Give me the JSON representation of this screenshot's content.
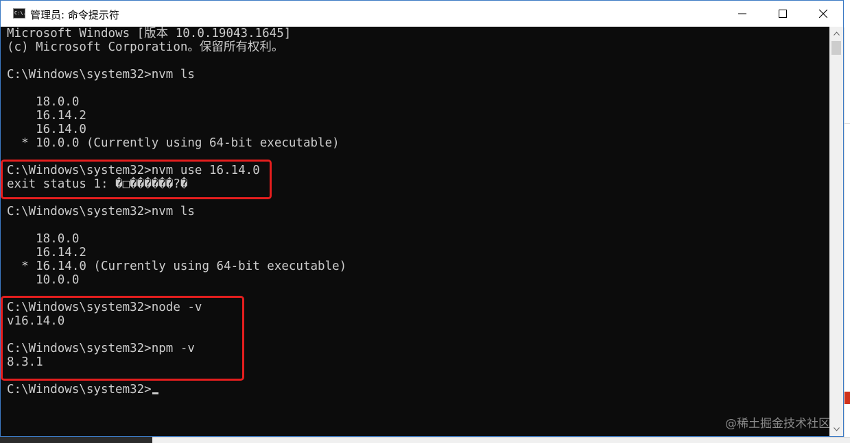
{
  "window": {
    "title": "管理员: 命令提示符",
    "app_icon_text": "C:\\.",
    "buttons": {
      "minimize_icon": "minimize-icon",
      "maximize_icon": "maximize-icon",
      "close_icon": "close-icon"
    }
  },
  "console": {
    "lines": [
      "Microsoft Windows [版本 10.0.19043.1645]",
      "(c) Microsoft Corporation。保留所有权利。",
      "",
      "C:\\Windows\\system32>nvm ls",
      "",
      "    18.0.0",
      "    16.14.2",
      "    16.14.0",
      "  * 10.0.0 (Currently using 64-bit executable)",
      "",
      "C:\\Windows\\system32>nvm use 16.14.0",
      "exit status 1: �□������?�",
      "",
      "C:\\Windows\\system32>nvm ls",
      "",
      "    18.0.0",
      "    16.14.2",
      "  * 16.14.0 (Currently using 64-bit executable)",
      "    10.0.0",
      "",
      "C:\\Windows\\system32>node -v",
      "v16.14.0",
      "",
      "C:\\Windows\\system32>npm -v",
      "8.3.1",
      "",
      "C:\\Windows\\system32>"
    ]
  },
  "colors": {
    "console_bg": "#0c0c0c",
    "console_text": "#cccccc",
    "highlight_border": "#e51e1e",
    "window_border": "#3c7ac4"
  },
  "watermark": "@稀土掘金技术社区"
}
